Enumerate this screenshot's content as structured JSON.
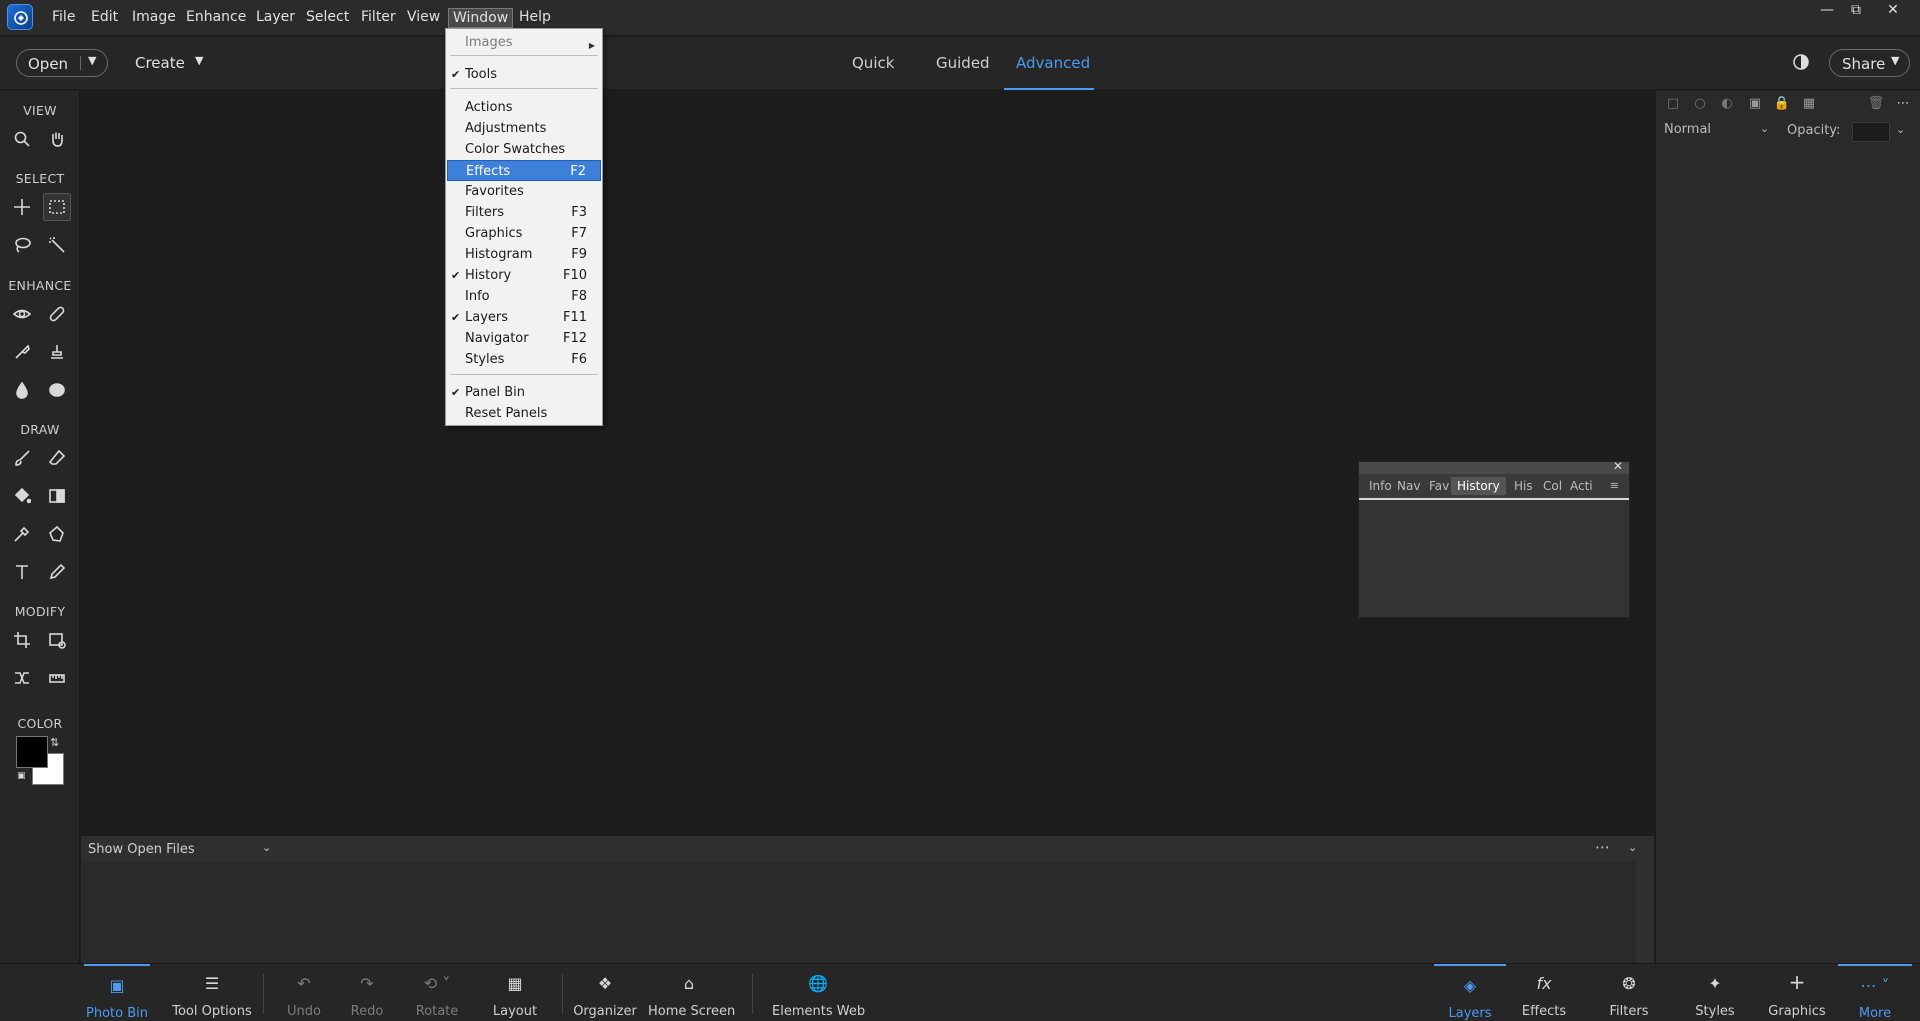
{
  "menubar": {
    "items": [
      "File",
      "Edit",
      "Image",
      "Enhance",
      "Layer",
      "Select",
      "Filter",
      "View",
      "Window",
      "Help"
    ],
    "active": "Window"
  },
  "toolbar": {
    "open_label": "Open",
    "create_label": "Create",
    "modes": [
      "Quick",
      "Guided",
      "Advanced"
    ],
    "active_mode": "Advanced",
    "share_label": "Share"
  },
  "tools": {
    "sections": [
      "VIEW",
      "SELECT",
      "ENHANCE",
      "DRAW",
      "MODIFY",
      "COLOR"
    ]
  },
  "window_menu": {
    "items": [
      {
        "label": "Images",
        "key": "",
        "checked": false,
        "disabled": true,
        "submenu": true
      },
      {
        "label": "Tools",
        "key": "",
        "checked": true
      },
      {
        "label": "Actions",
        "key": ""
      },
      {
        "label": "Adjustments",
        "key": ""
      },
      {
        "label": "Color Swatches",
        "key": ""
      },
      {
        "label": "Effects",
        "key": "F2",
        "highlighted": true
      },
      {
        "label": "Favorites",
        "key": ""
      },
      {
        "label": "Filters",
        "key": "F3"
      },
      {
        "label": "Graphics",
        "key": "F7"
      },
      {
        "label": "Histogram",
        "key": "F9"
      },
      {
        "label": "History",
        "key": "F10",
        "checked": true
      },
      {
        "label": "Info",
        "key": "F8"
      },
      {
        "label": "Layers",
        "key": "F11",
        "checked": true
      },
      {
        "label": "Navigator",
        "key": "F12"
      },
      {
        "label": "Styles",
        "key": "F6"
      },
      {
        "label": "Panel Bin",
        "key": "",
        "checked": true
      },
      {
        "label": "Reset Panels",
        "key": ""
      }
    ]
  },
  "float_panel": {
    "tabs": [
      "Info",
      "Nav",
      "Fav",
      "History",
      "His",
      "Col",
      "Acti"
    ],
    "active_tab": "History"
  },
  "right_panel": {
    "blend_mode": "Normal",
    "opacity_label": "Opacity:"
  },
  "photo_bin": {
    "label": "Show Open Files"
  },
  "taskbar": {
    "left": [
      {
        "label": "Photo Bin",
        "icon": "photo-bin-icon",
        "active": true
      },
      {
        "label": "Tool Options",
        "icon": "tool-options-icon"
      },
      {
        "label": "Undo",
        "icon": "undo-icon",
        "disabled": true
      },
      {
        "label": "Redo",
        "icon": "redo-icon",
        "disabled": true
      },
      {
        "label": "Rotate",
        "icon": "rotate-icon",
        "disabled": true
      },
      {
        "label": "Layout",
        "icon": "layout-icon"
      },
      {
        "label": "Organizer",
        "icon": "organizer-icon"
      },
      {
        "label": "Home Screen",
        "icon": "home-icon"
      },
      {
        "label": "Elements Web",
        "icon": "globe-icon"
      }
    ],
    "right": [
      {
        "label": "Layers",
        "icon": "layers-icon",
        "active": true
      },
      {
        "label": "Effects",
        "icon": "fx-icon"
      },
      {
        "label": "Filters",
        "icon": "filters-icon"
      },
      {
        "label": "Styles",
        "icon": "styles-icon"
      },
      {
        "label": "Graphics",
        "icon": "plus-icon"
      },
      {
        "label": "More",
        "icon": "more-icon",
        "active": true
      }
    ]
  },
  "colors": {
    "accent": "#4c9bf0",
    "menu_highlight": "#3d7fd9",
    "foreground_color": "#000000",
    "background_color": "#ffffff"
  }
}
